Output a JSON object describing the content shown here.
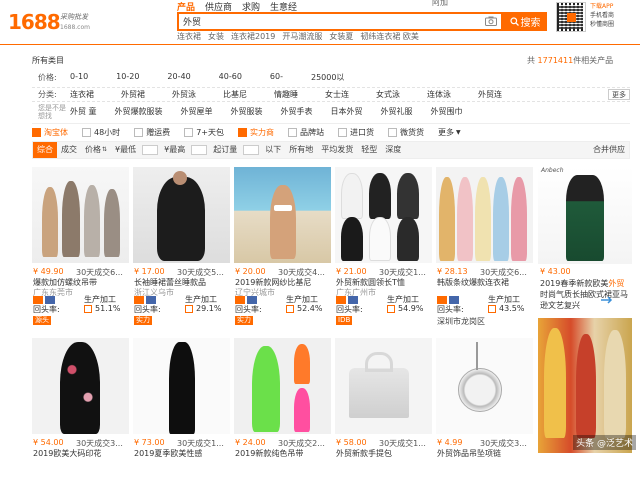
{
  "logo": {
    "number": "1688",
    "slogan": "采购批发",
    "domain": "1688.com"
  },
  "search_tabs": [
    {
      "label": "产品",
      "active": true
    },
    {
      "label": "供应商",
      "active": false
    },
    {
      "label": "求购",
      "active": false
    },
    {
      "label": "生意经",
      "active": false
    }
  ],
  "top_user": "阿加",
  "search": {
    "value": "外贸",
    "button": "搜索"
  },
  "hot_words": [
    "连衣裙",
    "女装",
    "连衣裙2019",
    "开马潮流服",
    "女装夏",
    "韧纬连衣裙 欧美"
  ],
  "app_download": {
    "line1": "下载APP",
    "line2": "手机看商",
    "line3": "秒懂商圈"
  },
  "breadcrumb": "所有类目",
  "result_count": {
    "prefix": "共",
    "count": "1771411",
    "suffix": "件相关产品"
  },
  "filters": {
    "price": {
      "label": "价格:",
      "options": [
        "0-10",
        "10-20",
        "20-40",
        "40-60",
        "60-",
        "25000以"
      ]
    },
    "category": {
      "label": "分类:",
      "options": [
        "连衣裙",
        "外贸裙",
        "外贸泳",
        "比基尼",
        "情趣睡",
        "女士连",
        "女式泳",
        "连体泳",
        "外贸连"
      ],
      "more": "更多"
    },
    "selected": {
      "label": "您是不是\n想找",
      "options": [
        "外贸 童",
        "外贸爆款服装",
        "外贸屋单",
        "外贸服装",
        "外贸手表",
        "日本外贸",
        "外贸礼服",
        "外贸围巾"
      ]
    }
  },
  "services": [
    {
      "label": "淘宝体",
      "hl": true
    },
    {
      "label": "48小时",
      "hl": false
    },
    {
      "label": "赠运费",
      "hl": false
    },
    {
      "label": "7+天包",
      "hl": false
    },
    {
      "label": "实力商",
      "hl": true
    },
    {
      "label": "品牌站",
      "hl": false
    },
    {
      "label": "进口货",
      "hl": false
    },
    {
      "label": "微货货",
      "hl": false
    },
    {
      "label": "更多",
      "hl": false
    }
  ],
  "sort": {
    "items": [
      "综合",
      "成交",
      "价格",
      "¥最低",
      "¥最高"
    ],
    "moq": "起订量",
    "below": "以下",
    "all_regions": "所有地",
    "flat": "平均发货",
    "light": "轻型",
    "deep": "深度",
    "right": "合并供应"
  },
  "products_row1": [
    {
      "price": "¥ 49.90",
      "sales": "30天成交6...",
      "title": "爆款加仿螺纹吊带",
      "sub": "广东东莞市",
      "produce": "生产加工",
      "repeat": "回头率:",
      "rate": "51.1%",
      "tag": "源头"
    },
    {
      "price": "¥ 17.00",
      "sales": "30天成交5...",
      "title": "长袖睡裙蕾丝睡款品",
      "sub": "浙江义乌市",
      "produce": "生产加工",
      "repeat": "回头率:",
      "rate": "29.1%",
      "tag": "实力"
    },
    {
      "price": "¥ 20.00",
      "sales": "30天成交4...",
      "title": "2019新款网纱比基尼",
      "sub": "辽宁兴城市",
      "produce": "生产加工",
      "repeat": "回头率:",
      "rate": "52.4%",
      "tag": "实力"
    },
    {
      "price": "¥ 21.00",
      "sales": "30天成交1...",
      "title": "外贸新款圆领长T恤",
      "sub": "广东广州市",
      "produce": "生产加工",
      "repeat": "回头率:",
      "rate": "54.9%",
      "tag": "IDB"
    },
    {
      "price": "¥ 28.13",
      "sales": "30天成交6...",
      "title": "韩版条纹爆款连衣裙",
      "sub": "深圳市龙岗区",
      "produce": "生产加工",
      "repeat": "回头率:",
      "rate": "43.5%",
      "tag": ""
    }
  ],
  "products_row2": [
    {
      "price": "¥ 54.00",
      "sales": "30天成交3...",
      "title": "2019欧美大码印花"
    },
    {
      "price": "¥ 73.00",
      "sales": "30天成交1...",
      "title": "2019夏季欧美性感"
    },
    {
      "price": "¥ 24.00",
      "sales": "30天成交2...",
      "title": "2019新款纯色吊带"
    },
    {
      "price": "¥ 58.00",
      "sales": "30天成交1...",
      "title": "外贸新款手提包"
    },
    {
      "price": "¥ 4.99",
      "sales": "30天成交3...",
      "title": "外贸饰品吊坠项链"
    }
  ],
  "side_ad": {
    "brand": "Anbech",
    "price": "¥ 43.00",
    "desc_pre": "2019春季新款欧美",
    "desc_hl": "外贸",
    "desc_post": "时尚气质长抽欧式裙亚马逊文艺复兴"
  },
  "watermark": "头条 @泛艺术"
}
